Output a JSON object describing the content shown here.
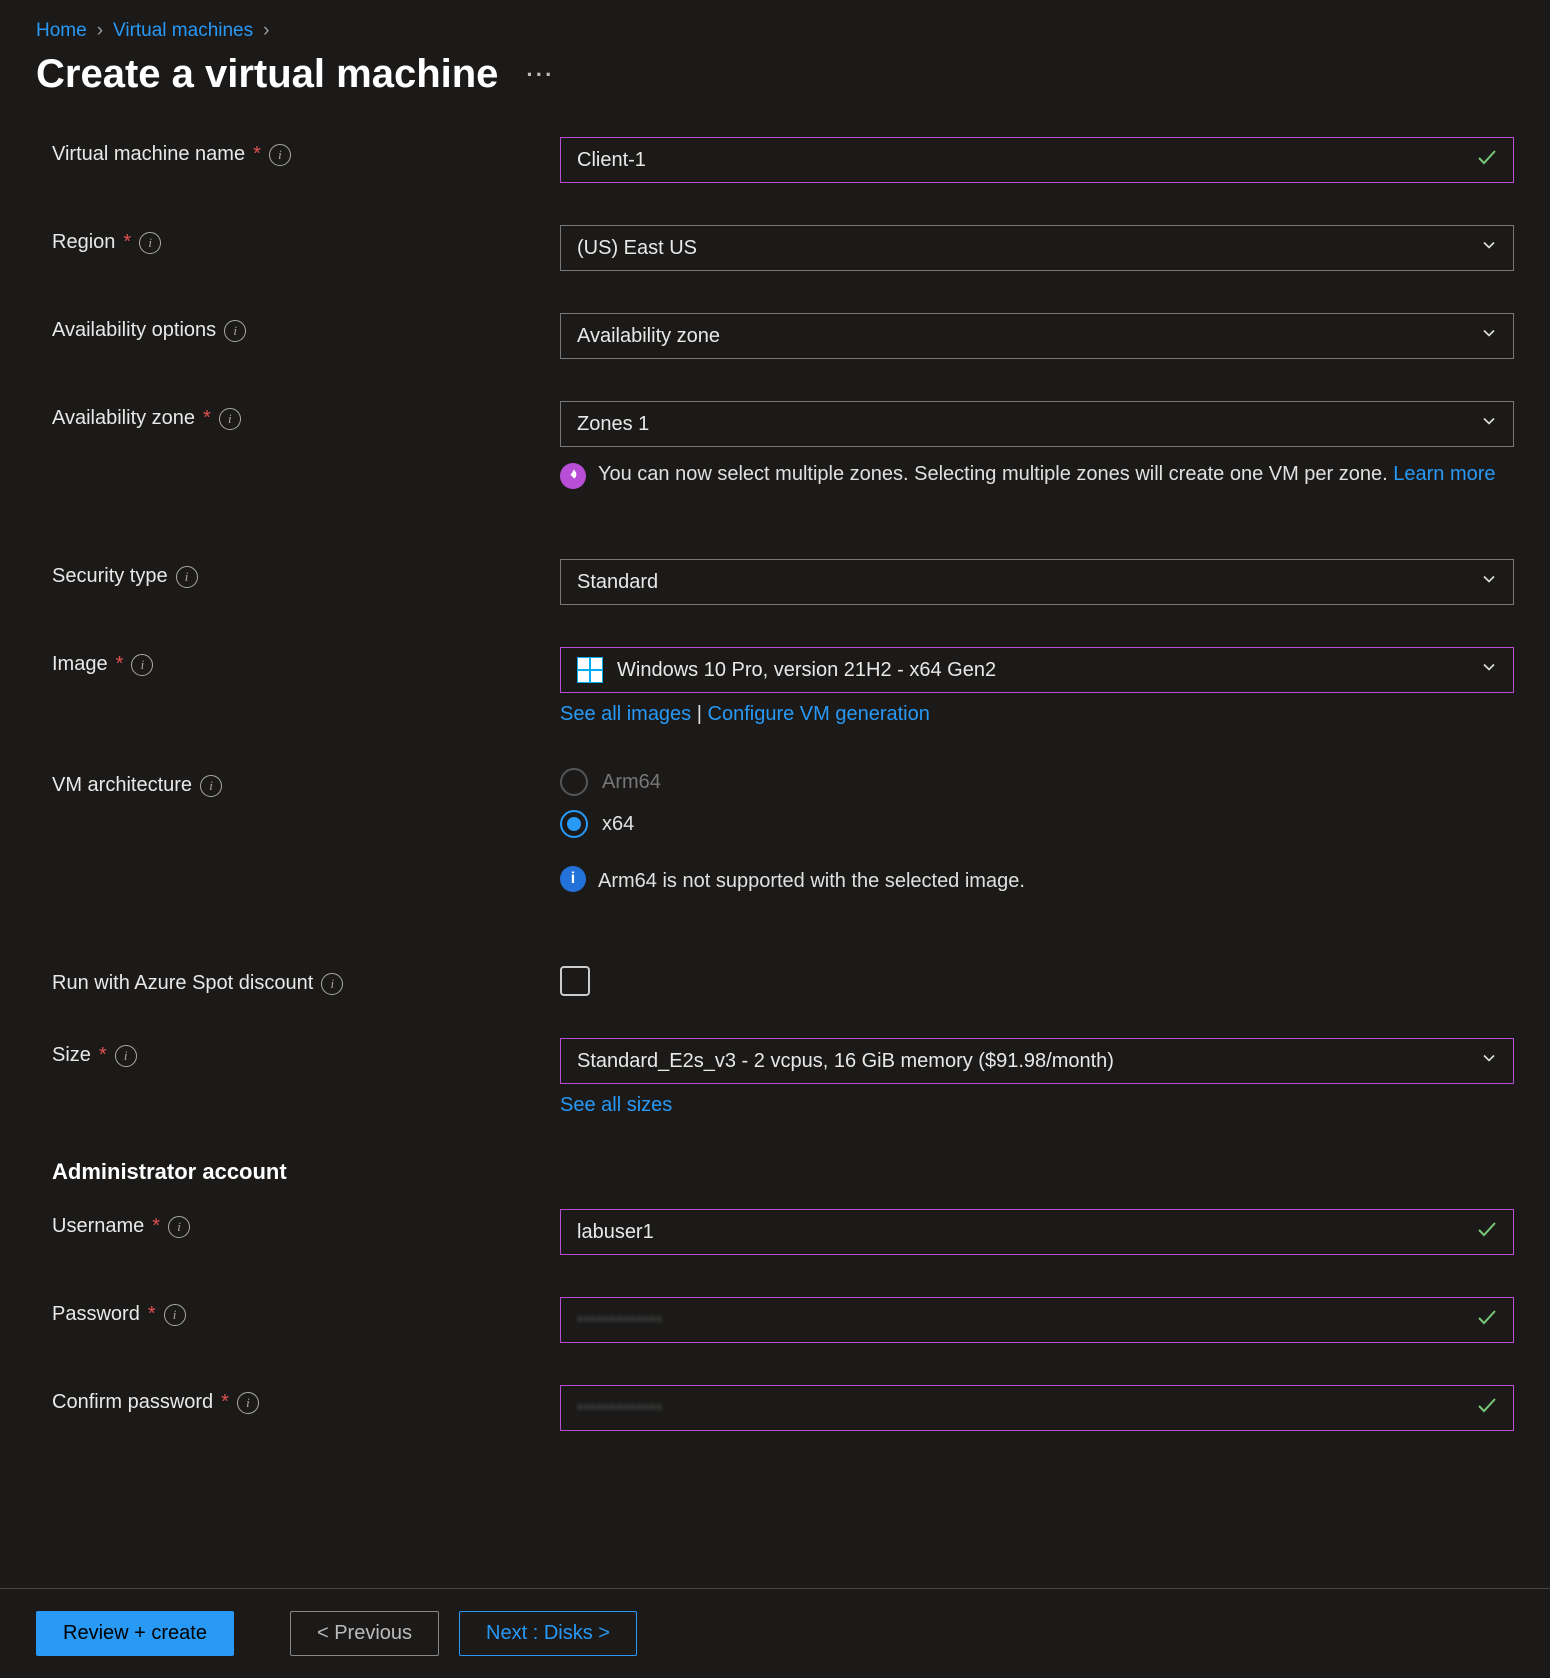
{
  "breadcrumb": {
    "home": "Home",
    "vms": "Virtual machines"
  },
  "title": "Create a virtual machine",
  "labels": {
    "vm_name": "Virtual machine name",
    "region": "Region",
    "avail_options": "Availability options",
    "avail_zone": "Availability zone",
    "security_type": "Security type",
    "image": "Image",
    "vm_arch": "VM architecture",
    "spot": "Run with Azure Spot discount",
    "size": "Size",
    "admin_section": "Administrator account",
    "username": "Username",
    "password": "Password",
    "confirm_password": "Confirm password"
  },
  "values": {
    "vm_name": "Client-1",
    "region": "(US) East US",
    "avail_options": "Availability zone",
    "avail_zone": "Zones 1",
    "security_type": "Standard",
    "image": "Windows 10 Pro, version 21H2 - x64 Gen2",
    "size": "Standard_E2s_v3 - 2 vcpus, 16 GiB memory ($91.98/month)",
    "username": "labuser1",
    "password_mask": "•••••••••••••",
    "confirm_password_mask": "•••••••••••••"
  },
  "hints": {
    "zone_msg": "You can now select multiple zones. Selecting multiple zones will create one VM per zone.",
    "arch_msg": "Arm64 is not supported with the selected image."
  },
  "links": {
    "learn_more": "Learn more",
    "see_all_images": "See all images",
    "configure_gen": "Configure VM generation",
    "see_all_sizes": "See all sizes"
  },
  "arch": {
    "arm64": "Arm64",
    "x64": "x64"
  },
  "footer": {
    "review": "Review + create",
    "previous": "< Previous",
    "next": "Next : Disks >"
  }
}
